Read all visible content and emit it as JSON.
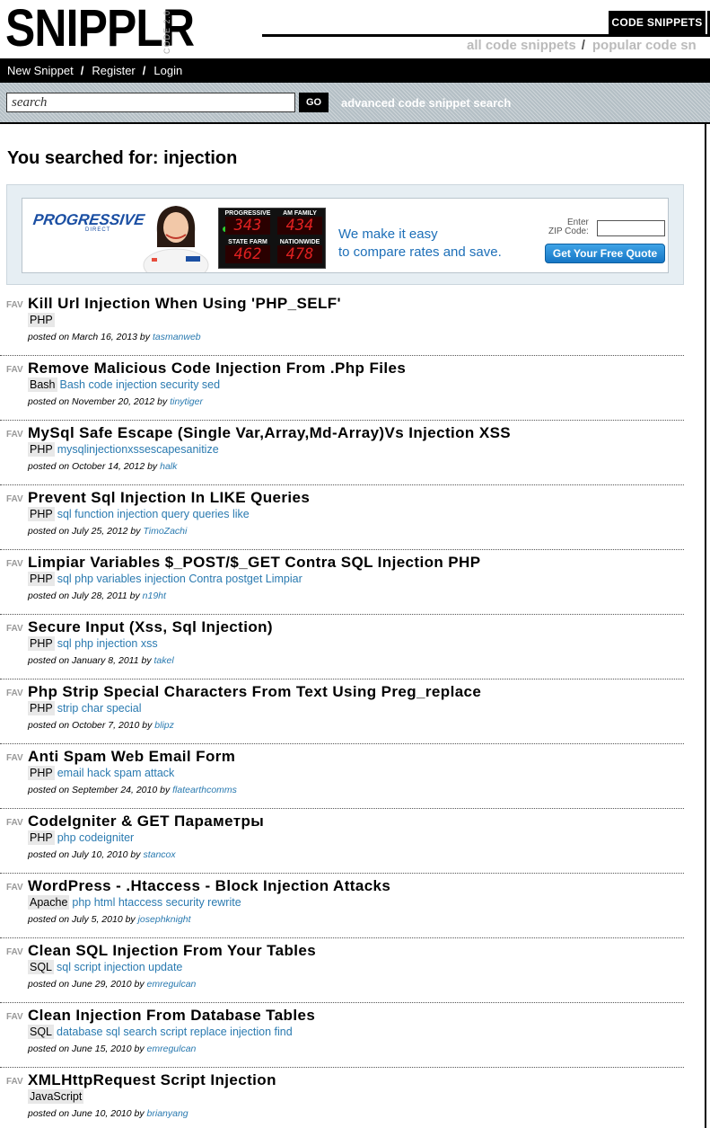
{
  "header": {
    "logo": "SNIPPLR",
    "logo_sub": "CODE 2.0",
    "active_tab": "CODE SNIPPETS",
    "subnav": [
      "all code snippets",
      "popular code sn"
    ],
    "subnav_sep": "/"
  },
  "navbar": {
    "items": [
      "New Snippet",
      "Register",
      "Login"
    ],
    "sep": "/"
  },
  "search": {
    "placeholder": "search",
    "go_label": "GO",
    "advanced_label": "advanced code snippet search"
  },
  "page": {
    "title": "You searched for: injection"
  },
  "ad": {
    "logo": "PROGRESSIVE",
    "logo_sub": "DIRECT",
    "board": [
      {
        "label": "PROGRESSIVE",
        "value": "343"
      },
      {
        "label": "AM FAMILY",
        "value": "434"
      },
      {
        "label": "STATE FARM",
        "value": "462"
      },
      {
        "label": "NATIONWIDE",
        "value": "478"
      }
    ],
    "tagline_1": "We make it easy",
    "tagline_2": "to compare rates and save.",
    "zip_label_1": "Enter",
    "zip_label_2": "ZIP Code:",
    "button": "Get Your Free Quote"
  },
  "results": [
    {
      "fav": "FAV",
      "title": "Kill Url Injection When Using 'PHP_SELF'",
      "lang": "PHP",
      "tags": "",
      "posted": "posted on March 16, 2013 by",
      "user": "tasmanweb"
    },
    {
      "fav": "FAV",
      "title": "Remove Malicious Code Injection From .Php Files",
      "lang": "Bash",
      "tags": "Bash code injection security sed",
      "posted": "posted on November 20, 2012 by",
      "user": "tinytiger"
    },
    {
      "fav": "FAV",
      "title": "MySql Safe Escape (Single Var,Array,Md-Array)Vs Injection XSS",
      "lang": "PHP",
      "tags": "mysqlinjectionxssescapesanitize",
      "posted": "posted on October 14, 2012 by",
      "user": "halk"
    },
    {
      "fav": "FAV",
      "title": "Prevent Sql Injection In LIKE Queries",
      "lang": "PHP",
      "tags": "sql function injection query queries like",
      "posted": "posted on July 25, 2012 by",
      "user": "TimoZachi"
    },
    {
      "fav": "FAV",
      "title": "Limpiar Variables $_POST/$_GET Contra SQL Injection PHP",
      "lang": "PHP",
      "tags": "sql php variables injection Contra postget Limpiar",
      "posted": "posted on July 28, 2011 by",
      "user": "n19ht"
    },
    {
      "fav": "FAV",
      "title": "Secure Input (Xss, Sql Injection)",
      "lang": "PHP",
      "tags": "sql php injection xss",
      "posted": "posted on January 8, 2011 by",
      "user": "takel"
    },
    {
      "fav": "FAV",
      "title": "Php Strip Special Characters From Text Using Preg_replace",
      "lang": "PHP",
      "tags": "strip char special",
      "posted": "posted on October 7, 2010 by",
      "user": "blipz"
    },
    {
      "fav": "FAV",
      "title": "Anti Spam Web Email Form",
      "lang": "PHP",
      "tags": "email hack spam attack",
      "posted": "posted on September 24, 2010 by",
      "user": "flatearthcomms"
    },
    {
      "fav": "FAV",
      "title": "CodeIgniter & GET Параметры",
      "lang": "PHP",
      "tags": "php codeigniter",
      "posted": "posted on July 10, 2010 by",
      "user": "stancox"
    },
    {
      "fav": "FAV",
      "title": "WordPress - .Htaccess - Block Injection Attacks",
      "lang": "Apache",
      "tags": "php html htaccess security rewrite",
      "posted": "posted on July 5, 2010 by",
      "user": "josephknight"
    },
    {
      "fav": "FAV",
      "title": "Clean SQL Injection From Your Tables",
      "lang": "SQL",
      "tags": "sql script injection update",
      "posted": "posted on June 29, 2010 by",
      "user": "emregulcan"
    },
    {
      "fav": "FAV",
      "title": "Clean Injection From Database Tables",
      "lang": "SQL",
      "tags": "database sql search script replace injection find",
      "posted": "posted on June 15, 2010 by",
      "user": "emregulcan"
    },
    {
      "fav": "FAV",
      "title": "XMLHttpRequest Script Injection",
      "lang": "JavaScript",
      "tags": "",
      "posted": "posted on June 10, 2010 by",
      "user": "brianyang"
    }
  ]
}
